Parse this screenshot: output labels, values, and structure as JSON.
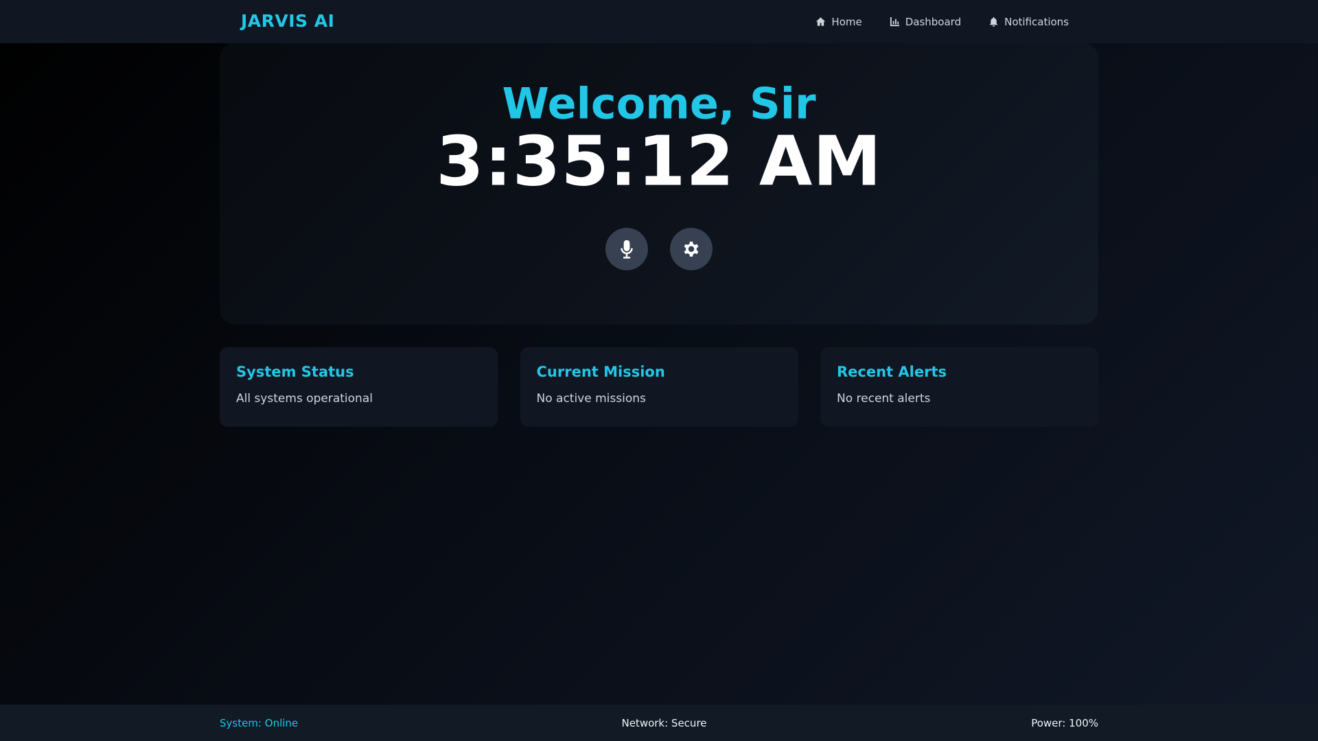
{
  "header": {
    "brand": "JARVIS AI",
    "nav": [
      {
        "label": "Home",
        "icon": "home-icon"
      },
      {
        "label": "Dashboard",
        "icon": "chart-icon"
      },
      {
        "label": "Notifications",
        "icon": "bell-icon"
      }
    ]
  },
  "hero": {
    "welcome": "Welcome, Sir",
    "time": "3:35:12 AM",
    "buttons": [
      {
        "icon": "microphone-icon"
      },
      {
        "icon": "gear-icon"
      }
    ]
  },
  "cards": [
    {
      "title": "System Status",
      "text": "All systems operational"
    },
    {
      "title": "Current Mission",
      "text": "No active missions"
    },
    {
      "title": "Recent Alerts",
      "text": "No recent alerts"
    }
  ],
  "footer": {
    "system": "System: Online",
    "network": "Network: Secure",
    "power": "Power: 100%"
  },
  "colors": {
    "accent": "#22c7e8",
    "background": "#000000",
    "panel": "#111722",
    "button": "#374151"
  }
}
